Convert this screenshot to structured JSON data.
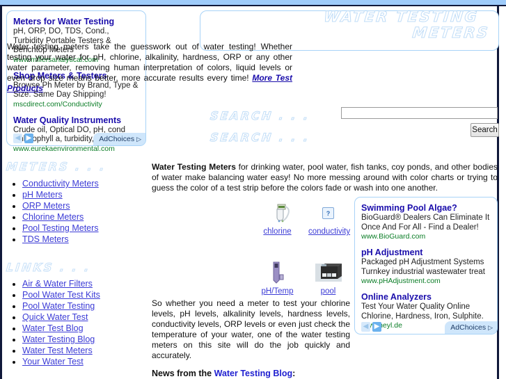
{
  "header": {
    "title_line1": "WATER TESTING",
    "title_line2": "METERS",
    "body_text": "Water testing meters take the guesswork out of water testing! Whether testing your water for pH, chlorine, alkalinity, hardness, ORP or any other water parameter, removing human interpretation of colors, liquid levels or even drop size means better, more accurate results every time! ",
    "body_link": "More Test Products"
  },
  "search": {
    "label_top": "SEARCH . . .",
    "label_bottom": "SEARCH . . .",
    "input_value": "",
    "button_label": "Search"
  },
  "left_ad": {
    "units": [
      {
        "title": "Meters for Water Testing",
        "desc": "pH, ORP, DO, TDS, Cond., Turbidity Portable Testers & Benchtop Meters",
        "url": "www.millersanalytical.com"
      },
      {
        "title": "Shop Meters & Testers",
        "desc": "Browse Ph Meter by Brand, Type & Size. Same Day Shipping!",
        "url": "mscdirect.com/Conductivity"
      },
      {
        "title": "Water Quality Instruments",
        "desc": "Crude oil, Optical DO, pH, cond Chlorophyll a, turbidity, telemetry",
        "url": "www.eurekaenvironmental.com"
      }
    ],
    "prev_arrow": "◀",
    "next_arrow": "▶",
    "adchoices_label": "AdChoices",
    "adchoices_glyph": "▷"
  },
  "right_ad": {
    "units": [
      {
        "title": "Swimming Pool Algae?",
        "desc": "BioGuard® Dealers Can Eliminate It Once And For All - Find a Dealer!",
        "url": "www.BioGuard.com"
      },
      {
        "title": "pH Adjustment",
        "desc": "Packaged pH Adjustment Systems Turnkey industrial wastewater treat",
        "url": "www.pHAdjustment.com"
      },
      {
        "title": "Online Analyzers",
        "desc": "Test Your Water Quality Online Chlorine, Hardness, Iron, Sulphite.",
        "url": "www.heyl.de"
      }
    ],
    "prev_arrow": "◀",
    "next_arrow": "▶",
    "adchoices_label": "AdChoices",
    "adchoices_glyph": "▷"
  },
  "sidebar": {
    "meters_heading": "METERS . . .",
    "meters_items": [
      "Conductivity Meters",
      "pH Meters",
      "ORP Meters",
      "Chlorine Meters",
      "Pool Testing Meters",
      "TDS Meters"
    ],
    "links_heading": "LINKS . . .",
    "links_items": [
      "Air & Water Filters",
      "Pool Water Test Kits",
      "Pool Water Testing",
      "Quick Water Test",
      "Water Test Blog",
      "Water Testing Blog",
      "Water Test Meters",
      "Your Water Test"
    ]
  },
  "main": {
    "para1_bold": "Water Testing Meters",
    "para1_rest": " for drinking water, pool water, fish tanks, coy ponds, and other bodies of water make balancing water easy! No more messing around with color charts or trying to guess the color of a test strip before the colors fade or wash into one another.",
    "para2": "So whether you need a meter to test your chlorine levels, pH levels, alkalinity levels, hardness levels, conductivity levels, ORP levels or even just check the temperature of your water, one of the water testing meters on this site will do the job quickly and accurately.",
    "news_prefix": "News from the ",
    "news_link": "Water Testing Blog",
    "news_suffix": ":",
    "thumbs": [
      {
        "caption": "chlorine",
        "icon": "chlorine-meter-photo"
      },
      {
        "caption": "conductivity",
        "icon": "broken-image-icon",
        "broken_glyph": "?"
      },
      {
        "caption": "pH/Temp",
        "icon": "ph-temp-meter-photo"
      },
      {
        "caption": "pool",
        "icon": "pool-meter-photo"
      }
    ]
  },
  "colors": {
    "frame_navy": "#10183a",
    "top_strip": "#9ecbfa",
    "panel_border": "#a8d3f7",
    "ad_title": "#1a0dab",
    "ad_url": "#0a7d26",
    "link_blue": "#3b3bd6",
    "outline_blue": "#bfdcf7"
  }
}
